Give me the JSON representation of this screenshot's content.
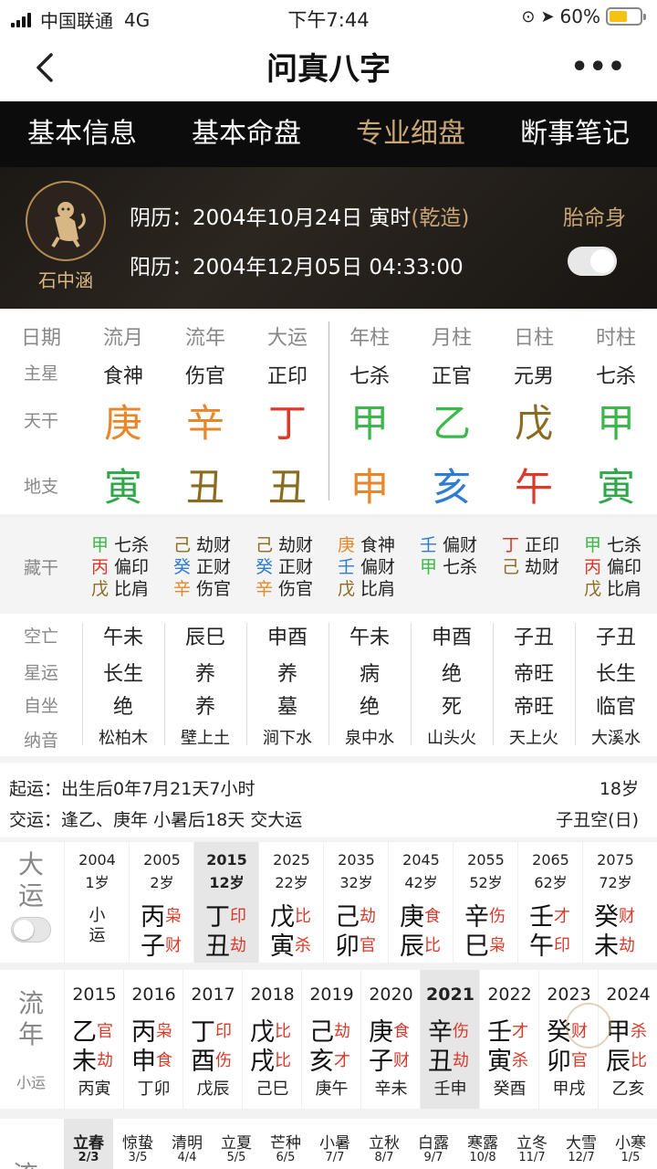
{
  "status": {
    "carrier": "中国联通",
    "network": "4G",
    "time": "下午7:44",
    "battery": "60%",
    "battery_level": 0.6
  },
  "nav": {
    "title": "问真八字",
    "more": "•••"
  },
  "tabs": [
    {
      "label": "基本信息"
    },
    {
      "label": "基本命盘"
    },
    {
      "label": "专业细盘"
    },
    {
      "label": "断事笔记"
    }
  ],
  "header": {
    "name": "石中涵",
    "lunar_label": "阴历：",
    "lunar_date": "2004年10月24日 寅时",
    "gender_tag": "(乾造)",
    "solar_label": "阳历：",
    "solar_date": "2004年12月05日 04:33:00",
    "taiming": "胎命身"
  },
  "pillars": {
    "row_labels": {
      "date": "日期",
      "main_star": "主星",
      "tiangan": "天干",
      "dizhi": "地支"
    },
    "columns": [
      {
        "head": "流月",
        "star": "食神",
        "gan": "庚",
        "gan_color": "#e8862a",
        "zhi": "寅",
        "zhi_color": "#2fa84a"
      },
      {
        "head": "流年",
        "star": "伤官",
        "gan": "辛",
        "gan_color": "#e8862a",
        "zhi": "丑",
        "zhi_color": "#8b6b1f"
      },
      {
        "head": "大运",
        "star": "正印",
        "gan": "丁",
        "gan_color": "#d93a2b",
        "zhi": "丑",
        "zhi_color": "#8b6b1f"
      },
      {
        "head": "年柱",
        "star": "七杀",
        "gan": "甲",
        "gan_color": "#3cb84b",
        "zhi": "申",
        "zhi_color": "#e8862a"
      },
      {
        "head": "月柱",
        "star": "正官",
        "gan": "乙",
        "gan_color": "#3cb84b",
        "zhi": "亥",
        "zhi_color": "#2f7bd0"
      },
      {
        "head": "日柱",
        "star": "元男",
        "gan": "戊",
        "gan_color": "#8b6b1f",
        "zhi": "午",
        "zhi_color": "#d93a2b"
      },
      {
        "head": "时柱",
        "star": "七杀",
        "gan": "甲",
        "gan_color": "#3cb84b",
        "zhi": "寅",
        "zhi_color": "#2fa84a"
      }
    ]
  },
  "canggan": {
    "label": "藏干",
    "columns": [
      [
        {
          "g": "甲",
          "c": "#3cb84b",
          "s": "七杀"
        },
        {
          "g": "丙",
          "c": "#d93a2b",
          "s": "偏印"
        },
        {
          "g": "戊",
          "c": "#8b6b1f",
          "s": "比肩"
        }
      ],
      [
        {
          "g": "己",
          "c": "#8b6b1f",
          "s": "劫财"
        },
        {
          "g": "癸",
          "c": "#2f7bd0",
          "s": "正财"
        },
        {
          "g": "辛",
          "c": "#e8862a",
          "s": "伤官"
        }
      ],
      [
        {
          "g": "己",
          "c": "#8b6b1f",
          "s": "劫财"
        },
        {
          "g": "癸",
          "c": "#2f7bd0",
          "s": "正财"
        },
        {
          "g": "辛",
          "c": "#e8862a",
          "s": "伤官"
        }
      ],
      [
        {
          "g": "庚",
          "c": "#e8862a",
          "s": "食神"
        },
        {
          "g": "壬",
          "c": "#2f7bd0",
          "s": "偏财"
        },
        {
          "g": "戊",
          "c": "#8b6b1f",
          "s": "比肩"
        }
      ],
      [
        {
          "g": "壬",
          "c": "#2f7bd0",
          "s": "偏财"
        },
        {
          "g": "甲",
          "c": "#3cb84b",
          "s": "七杀"
        }
      ],
      [
        {
          "g": "丁",
          "c": "#d93a2b",
          "s": "正印"
        },
        {
          "g": "己",
          "c": "#8b6b1f",
          "s": "劫财"
        }
      ],
      [
        {
          "g": "甲",
          "c": "#3cb84b",
          "s": "七杀"
        },
        {
          "g": "丙",
          "c": "#d93a2b",
          "s": "偏印"
        },
        {
          "g": "戊",
          "c": "#8b6b1f",
          "s": "比肩"
        }
      ]
    ]
  },
  "info_rows": [
    {
      "label": "空亡",
      "values": [
        "午未",
        "辰巳",
        "申酉",
        "午未",
        "申酉",
        "子丑",
        "子丑"
      ]
    },
    {
      "label": "星运",
      "values": [
        "长生",
        "养",
        "养",
        "病",
        "绝",
        "帝旺",
        "长生"
      ]
    },
    {
      "label": "自坐",
      "values": [
        "绝",
        "养",
        "墓",
        "绝",
        "死",
        "帝旺",
        "临官"
      ]
    },
    {
      "label": "纳音",
      "values": [
        "松柏木",
        "壁上土",
        "涧下水",
        "泉中水",
        "山头火",
        "天上火",
        "大溪水"
      ]
    }
  ],
  "qiyun": {
    "line1": "起运：出生后0年7月21天7小时",
    "line1_right": "18岁",
    "line2": "交运：逢乙、庚年 小暑后18天 交大运",
    "line2_right": "子丑空(日)"
  },
  "dayun": {
    "label": "大运",
    "items": [
      {
        "year": "2004",
        "age": "1岁",
        "xiao": "小运"
      },
      {
        "year": "2005",
        "age": "2岁",
        "g": "丙",
        "gs": "枭",
        "z": "子",
        "zs": "财"
      },
      {
        "year": "2015",
        "age": "12岁",
        "g": "丁",
        "gs": "印",
        "z": "丑",
        "zs": "劫",
        "sel": true
      },
      {
        "year": "2025",
        "age": "22岁",
        "g": "戊",
        "gs": "比",
        "z": "寅",
        "zs": "杀"
      },
      {
        "year": "2035",
        "age": "32岁",
        "g": "己",
        "gs": "劫",
        "z": "卯",
        "zs": "官"
      },
      {
        "year": "2045",
        "age": "42岁",
        "g": "庚",
        "gs": "食",
        "z": "辰",
        "zs": "比"
      },
      {
        "year": "2055",
        "age": "52岁",
        "g": "辛",
        "gs": "伤",
        "z": "巳",
        "zs": "枭"
      },
      {
        "year": "2065",
        "age": "62岁",
        "g": "壬",
        "gs": "才",
        "z": "午",
        "zs": "印"
      },
      {
        "year": "2075",
        "age": "72岁",
        "g": "癸",
        "gs": "财",
        "z": "未",
        "zs": "劫"
      }
    ]
  },
  "liunian": {
    "label": "流年",
    "xiaoyun_label": "小运",
    "items": [
      {
        "year": "2015",
        "g": "乙",
        "gs": "官",
        "z": "未",
        "zs": "劫",
        "xy": "丙寅"
      },
      {
        "year": "2016",
        "g": "丙",
        "gs": "枭",
        "z": "申",
        "zs": "食",
        "xy": "丁卯"
      },
      {
        "year": "2017",
        "g": "丁",
        "gs": "印",
        "z": "酉",
        "zs": "伤",
        "xy": "戊辰"
      },
      {
        "year": "2018",
        "g": "戊",
        "gs": "比",
        "z": "戌",
        "zs": "比",
        "xy": "己巳"
      },
      {
        "year": "2019",
        "g": "己",
        "gs": "劫",
        "z": "亥",
        "zs": "才",
        "xy": "庚午"
      },
      {
        "year": "2020",
        "g": "庚",
        "gs": "食",
        "z": "子",
        "zs": "财",
        "xy": "辛未"
      },
      {
        "year": "2021",
        "g": "辛",
        "gs": "伤",
        "z": "丑",
        "zs": "劫",
        "xy": "壬申",
        "sel": true
      },
      {
        "year": "2022",
        "g": "壬",
        "gs": "才",
        "z": "寅",
        "zs": "杀",
        "xy": "癸酉"
      },
      {
        "year": "2023",
        "g": "癸",
        "gs": "财",
        "z": "卯",
        "zs": "官",
        "xy": "甲戌"
      },
      {
        "year": "2024",
        "g": "甲",
        "gs": "杀",
        "z": "辰",
        "zs": "比",
        "xy": "乙亥"
      }
    ]
  },
  "jieqi": {
    "label": "流",
    "items": [
      {
        "n": "立春",
        "d": "2/3",
        "sel": true
      },
      {
        "n": "惊蛰",
        "d": "3/5"
      },
      {
        "n": "清明",
        "d": "4/4"
      },
      {
        "n": "立夏",
        "d": "5/5"
      },
      {
        "n": "芒种",
        "d": "6/5"
      },
      {
        "n": "小暑",
        "d": "7/7"
      },
      {
        "n": "立秋",
        "d": "8/7"
      },
      {
        "n": "白露",
        "d": "9/7"
      },
      {
        "n": "寒露",
        "d": "10/8"
      },
      {
        "n": "立冬",
        "d": "11/7"
      },
      {
        "n": "大雪",
        "d": "12/7"
      },
      {
        "n": "小寒",
        "d": "1/5"
      }
    ]
  },
  "colors": {
    "accent": "#c8a574",
    "tab_bg": "#0c0c0c",
    "red": "#d93a2b"
  }
}
